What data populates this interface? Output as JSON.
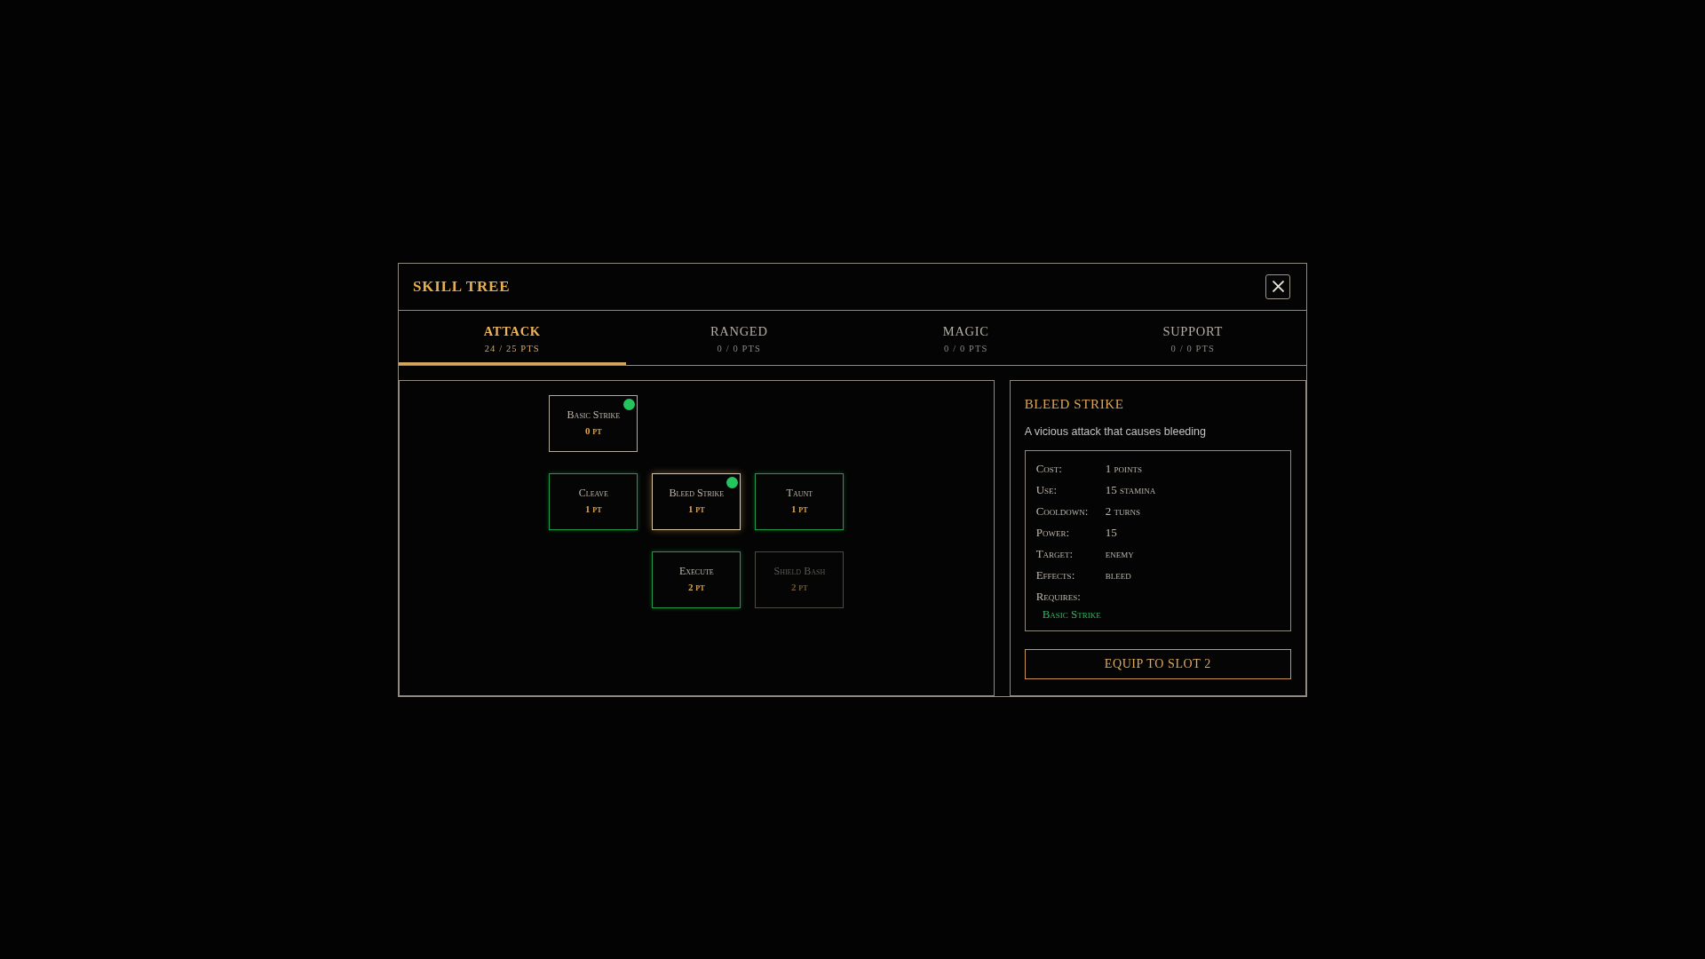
{
  "dialog": {
    "title": "SKILL TREE",
    "tabs": [
      {
        "label": "ATTACK",
        "points": "24 / 25 PTS",
        "selected": true
      },
      {
        "label": "RANGED",
        "points": "0 / 0 PTS",
        "selected": false
      },
      {
        "label": "MAGIC",
        "points": "0 / 0 PTS",
        "selected": false
      },
      {
        "label": "SUPPORT",
        "points": "0 / 0 PTS",
        "selected": false
      }
    ],
    "tree": {
      "nodes": [
        {
          "name": "Basic Strike",
          "cost": "0 pt",
          "learned": true,
          "locked": false,
          "selected": false,
          "children": [
            {
              "name": "Cleave",
              "cost": "1 pt",
              "learned": false,
              "locked": false,
              "selected": false
            },
            {
              "name": "Bleed Strike",
              "cost": "1 pt",
              "learned": true,
              "locked": false,
              "selected": true,
              "children": [
                {
                  "name": "Execute",
                  "cost": "2 pt",
                  "learned": false,
                  "locked": false,
                  "selected": false
                }
              ]
            },
            {
              "name": "Taunt",
              "cost": "1 pt",
              "learned": false,
              "locked": false,
              "selected": false,
              "children": [
                {
                  "name": "Shield Bash",
                  "cost": "2 pt",
                  "learned": false,
                  "locked": true,
                  "selected": false
                }
              ]
            }
          ]
        }
      ]
    },
    "detail": {
      "title": "BLEED STRIKE",
      "description": "A vicious attack that causes bleeding",
      "stats": [
        {
          "label": "Cost:",
          "value": "1 points"
        },
        {
          "label": "Use:",
          "value": "15 stamina"
        },
        {
          "label": "Cooldown:",
          "value": "2 turns"
        },
        {
          "label": "Power:",
          "value": "15"
        },
        {
          "label": "Target:",
          "value": "enemy"
        },
        {
          "label": "Effects:",
          "value": "bleed"
        }
      ],
      "requires": {
        "label": "Requires:",
        "items": [
          "Basic Strike"
        ]
      },
      "button": "EQUIP TO SLOT 2"
    }
  }
}
